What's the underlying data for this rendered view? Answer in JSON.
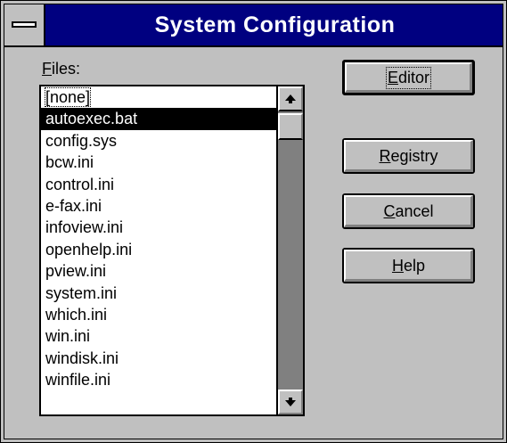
{
  "window": {
    "title": "System Configuration"
  },
  "files": {
    "label_mnemonic": "F",
    "label_rest": "iles:",
    "items": [
      "[none]",
      "autoexec.bat",
      "config.sys",
      "bcw.ini",
      "control.ini",
      "e-fax.ini",
      "infoview.ini",
      "openhelp.ini",
      "pview.ini",
      "system.ini",
      "which.ini",
      "win.ini",
      "windisk.ini",
      "winfile.ini"
    ],
    "selected_index": 1
  },
  "buttons": {
    "editor": {
      "mnemonic": "E",
      "rest": "ditor"
    },
    "registry": {
      "mnemonic": "R",
      "rest": "egistry"
    },
    "cancel": {
      "mnemonic": "C",
      "rest": "ancel"
    },
    "help": {
      "mnemonic": "H",
      "rest": "elp"
    }
  },
  "icons": {
    "system_menu": "system-menu-icon",
    "scroll_up": "arrow-up-icon",
    "scroll_down": "arrow-down-icon"
  },
  "colors": {
    "titlebar": "#000080",
    "face": "#c0c0c0",
    "selection": "#000000"
  }
}
